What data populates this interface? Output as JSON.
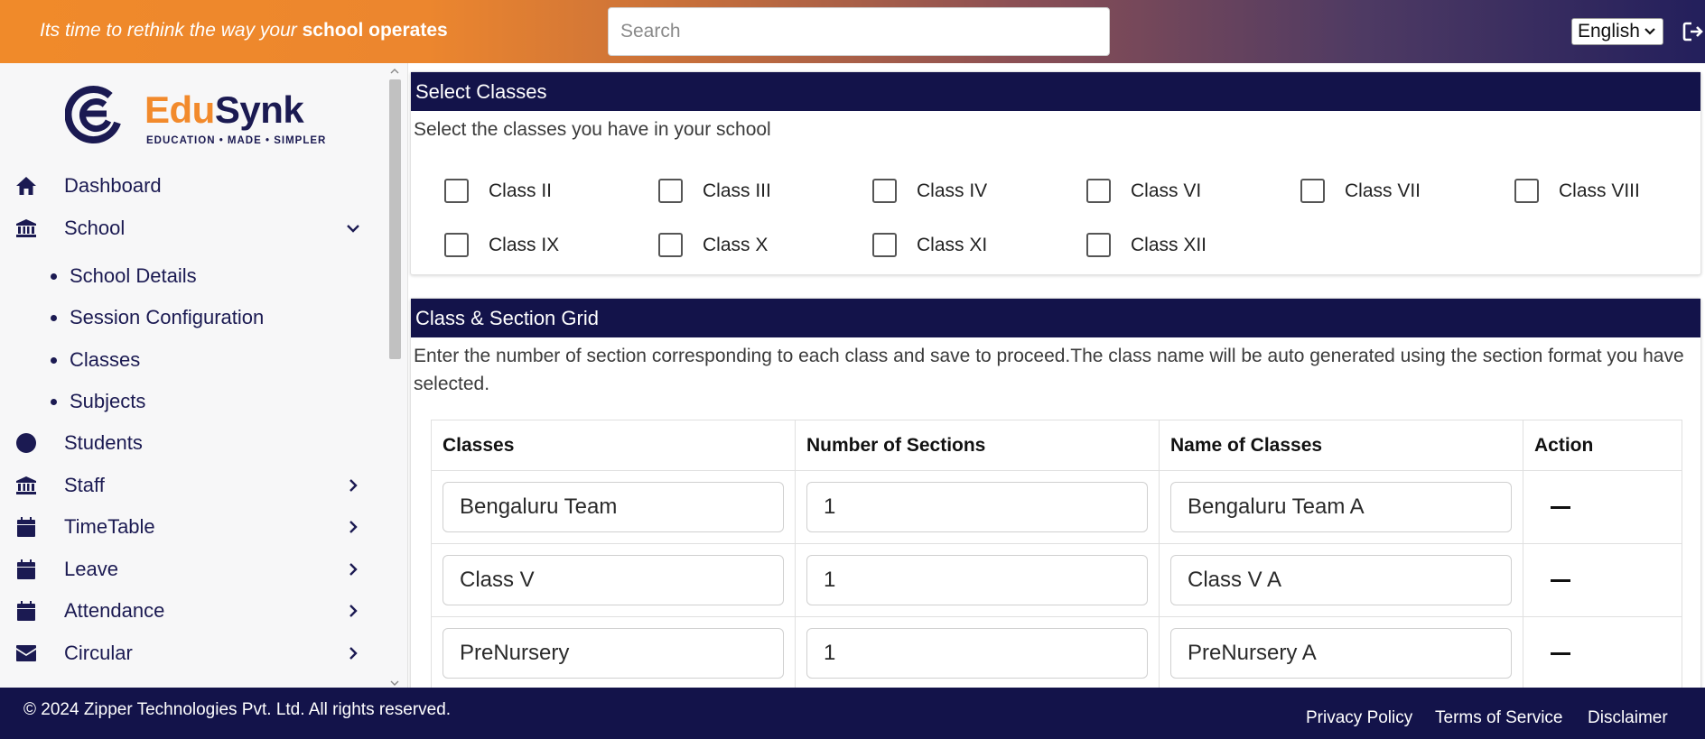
{
  "header": {
    "tagline_prefix": "Its time to rethink the way your ",
    "tagline_bold": "school operates",
    "search_placeholder": "Search",
    "language": "English"
  },
  "brand": {
    "name_part1": "Edu",
    "name_part2": "Synk",
    "tagline": "EDUCATION • MADE • SIMPLER",
    "orange": "#f28a2c",
    "navy": "#1b1a52"
  },
  "sidebar": {
    "items": [
      {
        "label": "Dashboard",
        "icon": "home-icon"
      },
      {
        "label": "School",
        "icon": "bank-icon",
        "expanded": true
      },
      {
        "label": "Students",
        "icon": "circle-icon"
      },
      {
        "label": "Staff",
        "icon": "bank-icon"
      },
      {
        "label": "TimeTable",
        "icon": "calendar-icon"
      },
      {
        "label": "Leave",
        "icon": "calendar-icon"
      },
      {
        "label": "Attendance",
        "icon": "calendar-icon"
      },
      {
        "label": "Circular",
        "icon": "envelope-icon"
      }
    ],
    "school_sub": [
      "School Details",
      "Session Configuration",
      "Classes",
      "Subjects"
    ]
  },
  "select_classes": {
    "title": "Select Classes",
    "description": "Select the classes you have in your school",
    "options": [
      "Class II",
      "Class III",
      "Class IV",
      "Class VI",
      "Class VII",
      "Class VIII",
      "Class IX",
      "Class X",
      "Class XI",
      "Class XII"
    ]
  },
  "grid": {
    "title": "Class & Section Grid",
    "description": "Enter the number of section corresponding to each class and save to proceed.The class name will be auto generated using the section format you have selected.",
    "headers": [
      "Classes",
      "Number of Sections",
      "Name of Classes",
      "Action"
    ],
    "rows": [
      {
        "class": "Bengaluru Team",
        "sections": "1",
        "name": "Bengaluru Team A"
      },
      {
        "class": "Class V",
        "sections": "1",
        "name": "Class V A"
      },
      {
        "class": "PreNursery",
        "sections": "1",
        "name": "PreNursery A"
      }
    ]
  },
  "footer": {
    "copyright": "© 2024 Zipper Technologies Pvt. Ltd. All rights reserved.",
    "links": [
      "Privacy Policy",
      "Terms of Service",
      "Disclaimer"
    ]
  },
  "colors": {
    "header_bg": "#13134a",
    "accent_orange": "#f08a2a"
  }
}
